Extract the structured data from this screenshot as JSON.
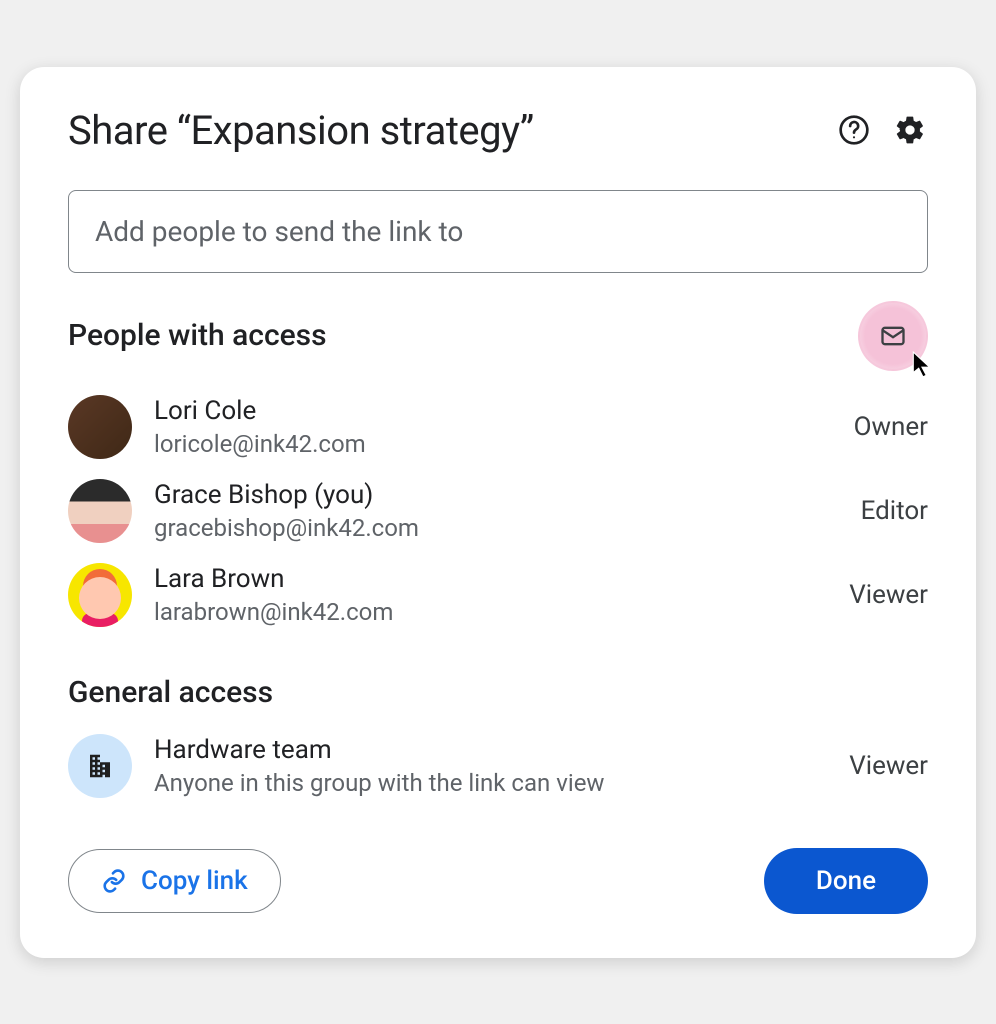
{
  "dialog": {
    "title": "Share “Expansion strategy”",
    "inputPlaceholder": "Add people to send the link to"
  },
  "sections": {
    "peopleTitle": "People with access",
    "generalTitle": "General access"
  },
  "people": [
    {
      "name": "Lori Cole",
      "email": "loricole@ink42.com",
      "role": "Owner"
    },
    {
      "name": "Grace Bishop (you)",
      "email": "gracebishop@ink42.com",
      "role": "Editor"
    },
    {
      "name": "Lara Brown",
      "email": "larabrown@ink42.com",
      "role": "Viewer"
    }
  ],
  "general": {
    "name": "Hardware team",
    "description": "Anyone in this group with the link can view",
    "role": "Viewer"
  },
  "footer": {
    "copyLink": "Copy link",
    "done": "Done"
  }
}
